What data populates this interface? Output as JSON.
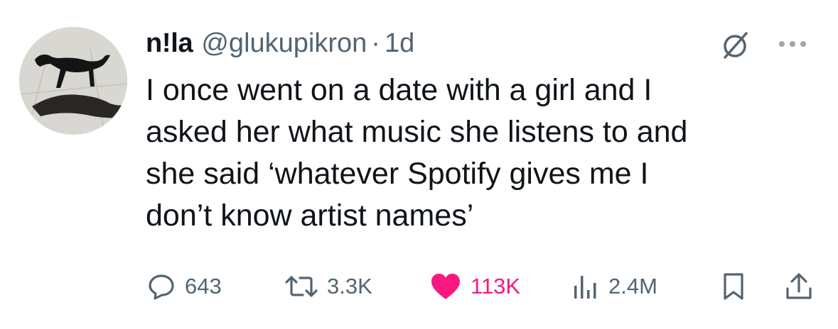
{
  "tweet": {
    "display_name": "n!la",
    "handle": "@glukupikron",
    "separator": "·",
    "time": "1d",
    "text": "I once went on a date with a girl and I\nasked her what music she listens to and\nshe said ‘whatever Spotify gives me I\ndon’t know artist names’"
  },
  "stats": {
    "replies": "643",
    "reposts": "3.3K",
    "likes": "113K",
    "views": "2.4M",
    "liked": true
  },
  "colors": {
    "text": "#0f1419",
    "secondary": "#536471",
    "like": "#f91880"
  },
  "icons": [
    "grok-icon",
    "more-icon",
    "reply-icon",
    "repost-icon",
    "heart-icon",
    "views-icon",
    "bookmark-icon",
    "share-icon"
  ]
}
